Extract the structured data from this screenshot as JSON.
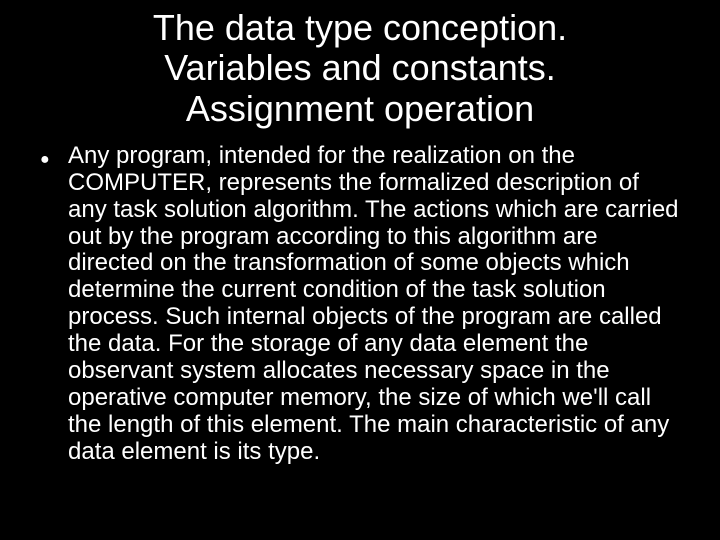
{
  "slide": {
    "title_line1": "The data type conception.",
    "title_line2": "Variables and constants.",
    "title_line3": "Assignment operation",
    "bullet_glyph": "●",
    "body": "Any program, intended for the realization on the COMPUTER, represents the formalized description of any task solution algorithm. The actions which are carried out by the program according to this algorithm are directed on the transformation of some objects which determine the current condition of the task solution process. Such internal objects of the program are called the data. For the storage of any data element the observant system allocates necessary space in the operative computer memory, the size of which we'll call the length of this element. The main characteristic of any data element is its type."
  }
}
